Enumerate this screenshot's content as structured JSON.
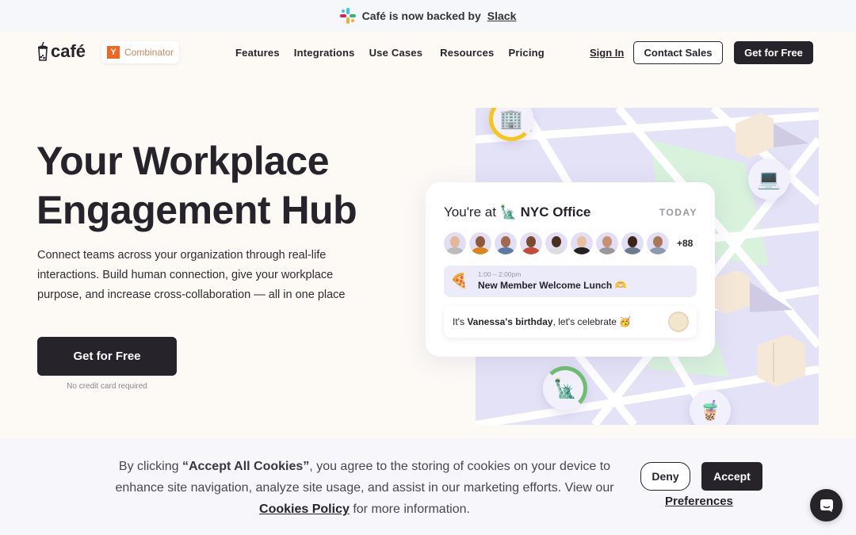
{
  "announcement": {
    "icon": "slack-icon",
    "text": "Café is now backed by",
    "link": "Slack"
  },
  "nav": {
    "logo": "café",
    "yc_letter": "Y",
    "yc_label": "Combinator",
    "links": [
      "Features",
      "Integrations",
      "Use Cases",
      "Resources",
      "Pricing"
    ],
    "sign_in": "Sign In",
    "contact_sales": "Contact Sales",
    "get_free": "Get for Free"
  },
  "hero": {
    "title_line1": "Your Workplace",
    "title_line2": "Engagement Hub",
    "description": "Connect teams across your organization through real-life interactions. Build human connection, give your workplace purpose, and increase cross-collaboration — all in one place",
    "cta": "Get for Free",
    "cta_note": "No credit card required"
  },
  "card": {
    "prefix": "You're at",
    "location_icon": "🗽",
    "location": "NYC Office",
    "day": "TODAY",
    "extra_count": "+88",
    "event_icon": "🍕",
    "event_time": "1:00 – 2:00pm",
    "event_name": "New Member Welcome Lunch 🫶",
    "bday_prefix": "It's",
    "bday_name": "Vanessa's birthday",
    "bday_suffix": ", let's celebrate 🥳"
  },
  "map": {
    "pins": [
      "🏢",
      "💻",
      "🗽",
      "🧋"
    ],
    "colors": {
      "bg": "#e4e2f6",
      "road": "#ffffff",
      "park": "#d8f2dc",
      "building": "#f5e8d7",
      "ring_yellow": "#f5c518",
      "ring_green": "#6cc070"
    }
  },
  "cookie": {
    "text_before": "By clicking",
    "text_bold": "“Accept All Cookies”",
    "text_after": ", you agree to the storing of cookies on your device to enhance site navigation, analyze site usage, and assist in our marketing efforts. View our",
    "policy_link": "Cookies Policy",
    "text_end": "for more information.",
    "deny": "Deny",
    "accept": "Accept",
    "preferences": "Preferences"
  },
  "colors": {
    "brand_dark": "#27232b",
    "page_bg": "#fdf9f5",
    "banner_bg": "#f6f7fb"
  }
}
